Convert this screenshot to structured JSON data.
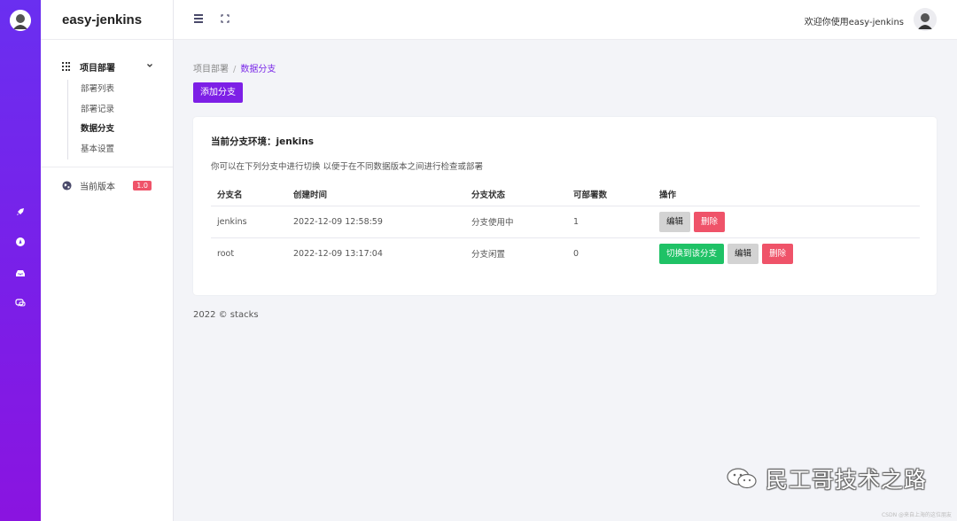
{
  "app": {
    "brand": "easy-jenkins"
  },
  "header": {
    "welcome": "欢迎你使用easy-jenkins"
  },
  "sidebar": {
    "group": {
      "label": "项目部署"
    },
    "items": [
      {
        "label": "部署列表"
      },
      {
        "label": "部署记录"
      },
      {
        "label": "数据分支",
        "active": true
      },
      {
        "label": "基本设置"
      }
    ],
    "version": {
      "label": "当前版本",
      "badge": "1.0"
    }
  },
  "breadcrumb": {
    "parent": "项目部署",
    "separator": "/",
    "current": "数据分支"
  },
  "toolbar": {
    "add_branch": "添加分支"
  },
  "card": {
    "title": "当前分支环境：jenkins",
    "description": "你可以在下列分支中进行切换 以便于在不同数据版本之间进行检查或部署",
    "columns": [
      "分支名",
      "创建时间",
      "分支状态",
      "可部署数",
      "操作"
    ],
    "rows": [
      {
        "name": "jenkins",
        "created": "2022-12-09 12:58:59",
        "status": "分支使用中",
        "count": "1",
        "actions": {
          "edit": "编辑",
          "delete": "删除"
        }
      },
      {
        "name": "root",
        "created": "2022-12-09 13:17:04",
        "status": "分支闲置",
        "count": "0",
        "actions": {
          "switch": "切换到该分支",
          "edit": "编辑",
          "delete": "删除"
        }
      }
    ]
  },
  "footer": {
    "text": "2022 © stacks"
  },
  "watermark": {
    "text": "民工哥技术之路",
    "small": "CSDN @来自上海的这位朋友"
  },
  "colors": {
    "accent": "#7d1fe6",
    "danger": "#ef5369",
    "success": "#1fc266",
    "rail_top": "#6a2ff0",
    "rail_bottom": "#8a14e0"
  },
  "icons": {
    "rail": [
      "rocket-icon",
      "compass-icon",
      "inbox-icon",
      "chat-icon"
    ],
    "header": [
      "menu-icon",
      "fullscreen-icon"
    ]
  }
}
